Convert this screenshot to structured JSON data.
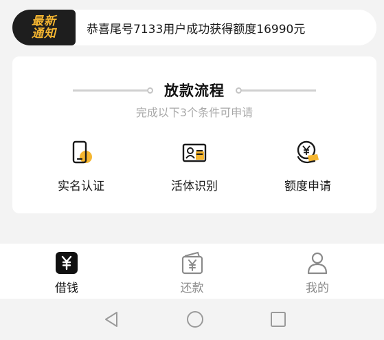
{
  "notice": {
    "badge_line1": "最新",
    "badge_line2": "通知",
    "text": "恭喜尾号7133用户成功获得额度16990元"
  },
  "process": {
    "title": "放款流程",
    "subtitle": "完成以下3个条件可申请",
    "steps": [
      {
        "label": "实名认证",
        "icon": "phone-icon"
      },
      {
        "label": "活体识别",
        "icon": "id-card-icon"
      },
      {
        "label": "额度申请",
        "icon": "yen-coin-hand-icon"
      }
    ]
  },
  "tabbar": {
    "tabs": [
      {
        "label": "借钱",
        "icon": "yen-square-icon",
        "active": true
      },
      {
        "label": "还款",
        "icon": "wallet-icon",
        "active": false
      },
      {
        "label": "我的",
        "icon": "user-icon",
        "active": false
      }
    ]
  },
  "system_nav": {
    "buttons": [
      "back-triangle-icon",
      "home-circle-icon",
      "recents-square-icon"
    ]
  },
  "colors": {
    "accent": "#f5b631",
    "badge_bg": "#1e1e1e",
    "page_bg": "#f3f3f3"
  }
}
